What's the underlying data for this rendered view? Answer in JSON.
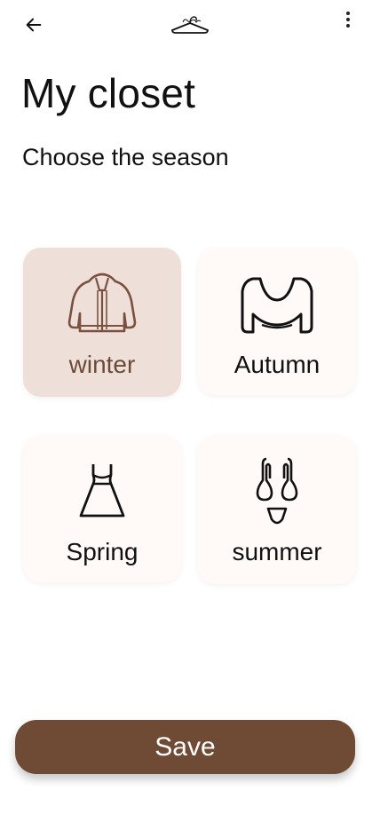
{
  "header": {
    "back_icon": "arrow-left-icon",
    "logo": "Styline hanger logo",
    "more_icon": "more-vert-icon"
  },
  "page": {
    "title": "My closet",
    "subtitle": "Choose the season"
  },
  "seasons": [
    {
      "label": "winter",
      "icon": "jacket-icon",
      "selected": true
    },
    {
      "label": "Autumn",
      "icon": "sweater-icon",
      "selected": false
    },
    {
      "label": "Spring",
      "icon": "dress-icon",
      "selected": false
    },
    {
      "label": "summer",
      "icon": "swimsuit-icon",
      "selected": false
    }
  ],
  "actions": {
    "save_label": "Save"
  },
  "colors": {
    "accent": "#6f4a35",
    "selected_card": "#eee0d8",
    "card_bg": "#fffaf7"
  }
}
